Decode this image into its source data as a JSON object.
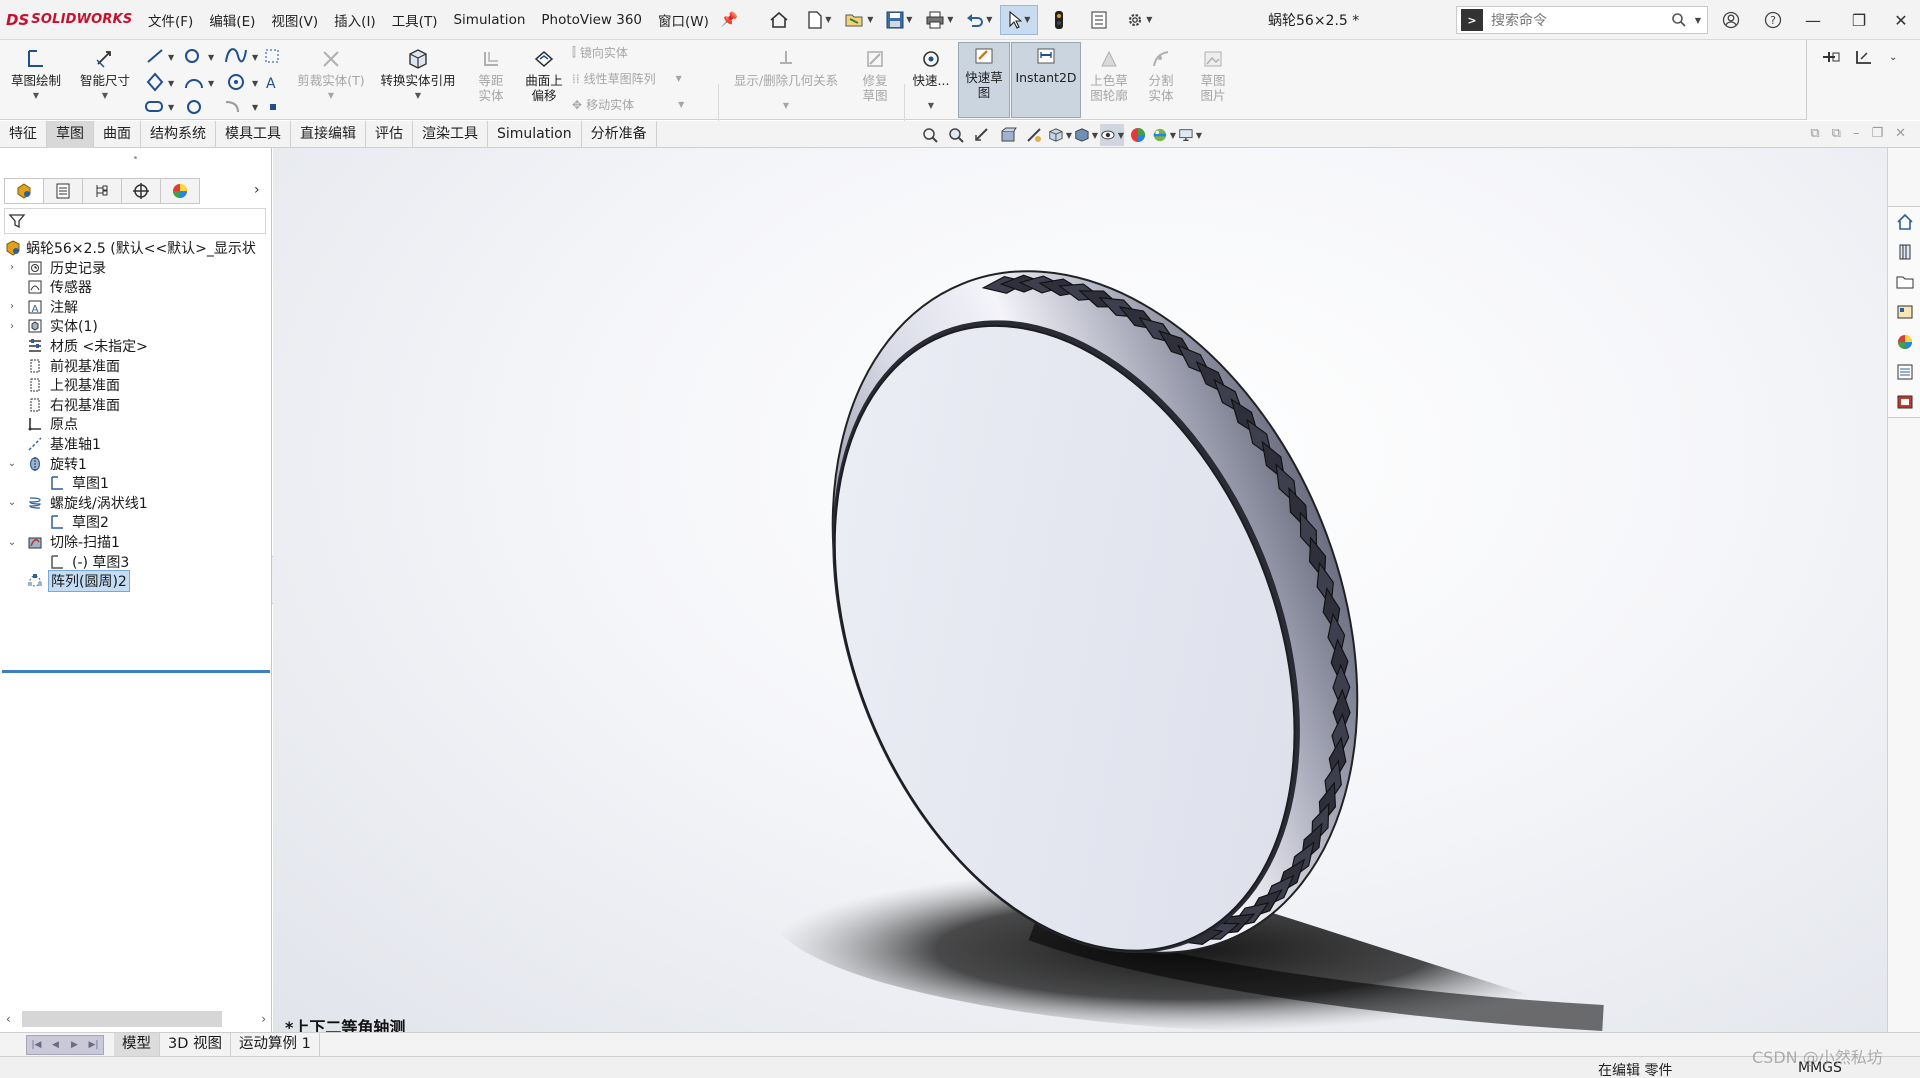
{
  "app": {
    "brand_mark": "DS",
    "brand_name": "SOLIDWORKS",
    "document_title": "蜗轮56×2.5 *"
  },
  "menu": [
    "文件(F)",
    "编辑(E)",
    "视图(V)",
    "插入(I)",
    "工具(T)",
    "Simulation",
    "PhotoView 360",
    "窗口(W)"
  ],
  "search": {
    "placeholder": "搜索命令"
  },
  "ribbon": {
    "sketch": "草图绘制",
    "smart_dim": "智能尺寸",
    "trim": "剪裁实体(T)",
    "convert": "转换实体引用",
    "offset": "等距实体",
    "offset_surface": "曲面上偏移",
    "mirror": "镜向实体",
    "linear_pattern": "线性草图阵列",
    "move": "移动实体",
    "relations": "显示/删除几何关系",
    "repair": "修复草图",
    "quick_snaps": "快速...",
    "rapid_sketch": "快速草图",
    "instant2d": "Instant2D",
    "shaded_contours": "上色草图轮廓",
    "split": "分割实体",
    "sketch_picture": "草图图片"
  },
  "tabs": [
    "特征",
    "草图",
    "曲面",
    "结构系统",
    "模具工具",
    "直接编辑",
    "评估",
    "渲染工具",
    "Simulation",
    "分析准备"
  ],
  "active_tab": "草图",
  "tree": {
    "root": "蜗轮56×2.5  (默认<<默认>_显示状",
    "items": [
      "历史记录",
      "传感器",
      "注解",
      "实体(1)",
      "材质 <未指定>",
      "前视基准面",
      "上视基准面",
      "右视基准面",
      "原点",
      "基准轴1",
      "旋转1",
      "草图1",
      "螺旋线/涡状线1",
      "草图2",
      "切除-扫描1",
      "(-) 草图3",
      "阵列(圆周)2"
    ]
  },
  "viewport": {
    "view_name": "*上下二等角轴测"
  },
  "bottom_tabs": [
    "模型",
    "3D 视图",
    "运动算例 1"
  ],
  "active_bottom_tab": "模型",
  "status": {
    "edit_mode": "在编辑 零件",
    "units": "MMGS"
  },
  "watermark": "CSDN @小然私坊"
}
